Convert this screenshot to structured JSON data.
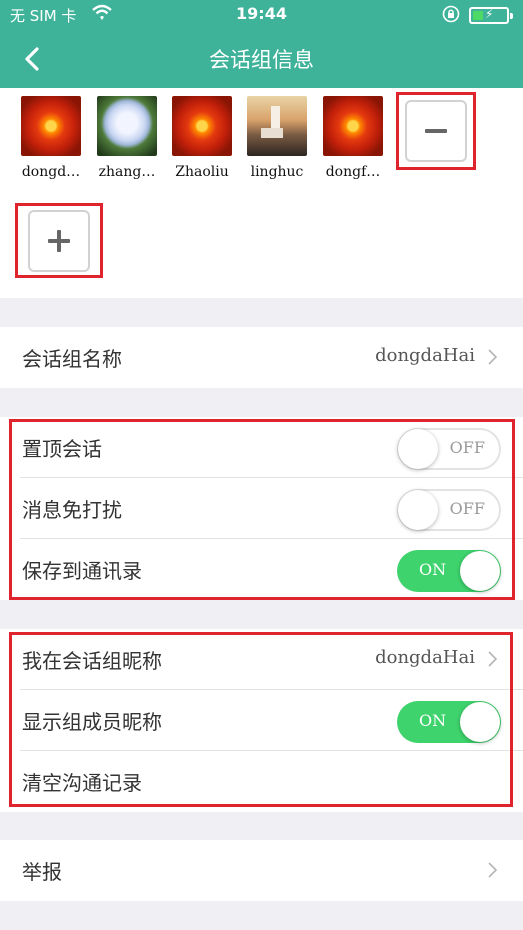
{
  "status_bar": {
    "carrier": "无 SIM 卡",
    "time": "19:44"
  },
  "nav": {
    "title": "会话组信息"
  },
  "members": [
    {
      "name": "dongd…"
    },
    {
      "name": "zhang…"
    },
    {
      "name": "Zhaoliu"
    },
    {
      "name": "linghuc"
    },
    {
      "name": "dongf…"
    }
  ],
  "settings": {
    "group_name": {
      "label": "会话组名称",
      "value": "dongdaHai"
    },
    "pin_chat": {
      "label": "置顶会话",
      "state": "OFF"
    },
    "mute": {
      "label": "消息免打扰",
      "state": "OFF"
    },
    "save_contacts": {
      "label": "保存到通讯录",
      "state": "ON"
    },
    "my_nickname": {
      "label": "我在会话组昵称",
      "value": "dongdaHai"
    },
    "show_nicknames": {
      "label": "显示组成员昵称",
      "state": "ON"
    },
    "clear_history": {
      "label": "清空沟通记录"
    },
    "report": {
      "label": "举报"
    }
  },
  "colors": {
    "accent": "#3fb39a",
    "toggle_on": "#3ed36d",
    "highlight_box": "#e0242e"
  }
}
